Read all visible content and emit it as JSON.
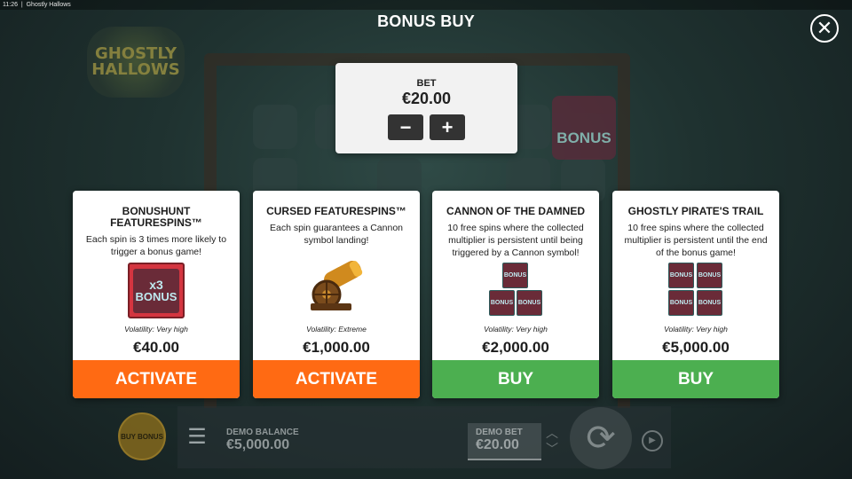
{
  "status_bar": {
    "time": "11:26",
    "app_name": "Ghostly Hallows"
  },
  "background": {
    "logo_text": "GHOSTLY HALLOWS",
    "reel_bonus_text": "BONUS"
  },
  "dialog": {
    "title": "BONUS BUY",
    "close_icon": "close-circle-icon",
    "bet": {
      "label": "BET",
      "value": "€20.00",
      "decrease": "−",
      "increase": "+"
    }
  },
  "cards": [
    {
      "title": "BONUSHUNT FEATURESPINS™",
      "description": "Each spin is 3 times more likely to trigger a bonus game!",
      "art": {
        "multiplier": "x3",
        "text": "BONUS"
      },
      "volatility": "Volatility: Very high",
      "price": "€40.00",
      "button": "ACTIVATE",
      "button_color": "#ff6a13"
    },
    {
      "title": "CURSED FEATURESPINS™",
      "description": "Each spin guarantees a Cannon symbol landing!",
      "art": {
        "icon": "cannon-icon"
      },
      "volatility": "Volatility: Extreme",
      "price": "€1,000.00",
      "button": "ACTIVATE",
      "button_color": "#ff6a13"
    },
    {
      "title": "CANNON OF THE DAMNED",
      "description": "10 free spins where the collected multiplier is persistent until being triggered by a Cannon symbol!",
      "art": {
        "text": "BONUS"
      },
      "volatility": "Volatility: Very high",
      "price": "€2,000.00",
      "button": "BUY",
      "button_color": "#4caf50"
    },
    {
      "title": "GHOSTLY PIRATE'S TRAIL",
      "description": "10 free spins where the collected multiplier is persistent until the end of the bonus game!",
      "art": {
        "text": "BONUS"
      },
      "volatility": "Volatility: Very high",
      "price": "€5,000.00",
      "button": "BUY",
      "button_color": "#4caf50"
    }
  ],
  "bottom_bar": {
    "buy_bonus": "BUY BONUS",
    "menu_icon": "hamburger-menu-icon",
    "balance_label": "DEMO BALANCE",
    "balance_value": "€5,000.00",
    "bet_label": "DEMO BET",
    "bet_value": "€20.00",
    "spin_icon": "spin-icon",
    "autoplay_icon": "autoplay-icon"
  }
}
